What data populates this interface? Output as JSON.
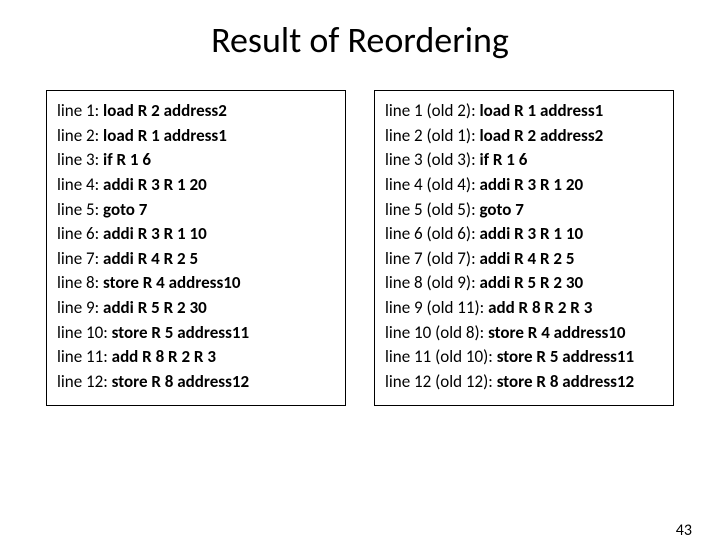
{
  "title": "Result of Reordering",
  "pageNumber": "43",
  "left": [
    {
      "prefix": "line 1: ",
      "code": "load R 2 address2"
    },
    {
      "prefix": "line 2: ",
      "code": "load R 1 address1"
    },
    {
      "prefix": "line 3: ",
      "code": "if R 1 6"
    },
    {
      "prefix": "line 4: ",
      "code": "addi R 3 R 1 20"
    },
    {
      "prefix": "line 5: ",
      "code": "goto 7"
    },
    {
      "prefix": "line 6: ",
      "code": "addi R 3 R 1 10"
    },
    {
      "prefix": "line 7: ",
      "code": "addi R 4 R 2 5"
    },
    {
      "prefix": "line 8: ",
      "code": "store R 4 address10"
    },
    {
      "prefix": "line 9: ",
      "code": "addi R 5 R 2 30"
    },
    {
      "prefix": "line 10: ",
      "code": "store R 5 address11"
    },
    {
      "prefix": "line 11: ",
      "code": "add R 8 R 2 R 3"
    },
    {
      "prefix": "line 12: ",
      "code": "store R 8 address12"
    }
  ],
  "right": [
    {
      "prefix": "line 1 (old 2): ",
      "code": "load R 1 address1"
    },
    {
      "prefix": "line 2 (old 1): ",
      "code": "load R 2 address2"
    },
    {
      "prefix": "line 3 (old 3): ",
      "code": "if R 1 6"
    },
    {
      "prefix": "line 4 (old 4): ",
      "code": "addi R 3 R 1 20"
    },
    {
      "prefix": "line 5 (old 5): ",
      "code": "goto 7"
    },
    {
      "prefix": "line 6 (old 6): ",
      "code": "addi R 3 R 1 10"
    },
    {
      "prefix": "line 7 (old 7): ",
      "code": "addi R 4 R 2 5"
    },
    {
      "prefix": "line 8 (old 9): ",
      "code": "addi R 5 R 2 30"
    },
    {
      "prefix": "line 9 (old 11): ",
      "code": "add R 8 R 2 R 3"
    },
    {
      "prefix": "line 10 (old 8): ",
      "code": "store R 4 address10"
    },
    {
      "prefix": "line 11 (old 10): ",
      "code": "store R 5 address11"
    },
    {
      "prefix": "line 12 (old 12): ",
      "code": "store R 8 address12"
    }
  ]
}
